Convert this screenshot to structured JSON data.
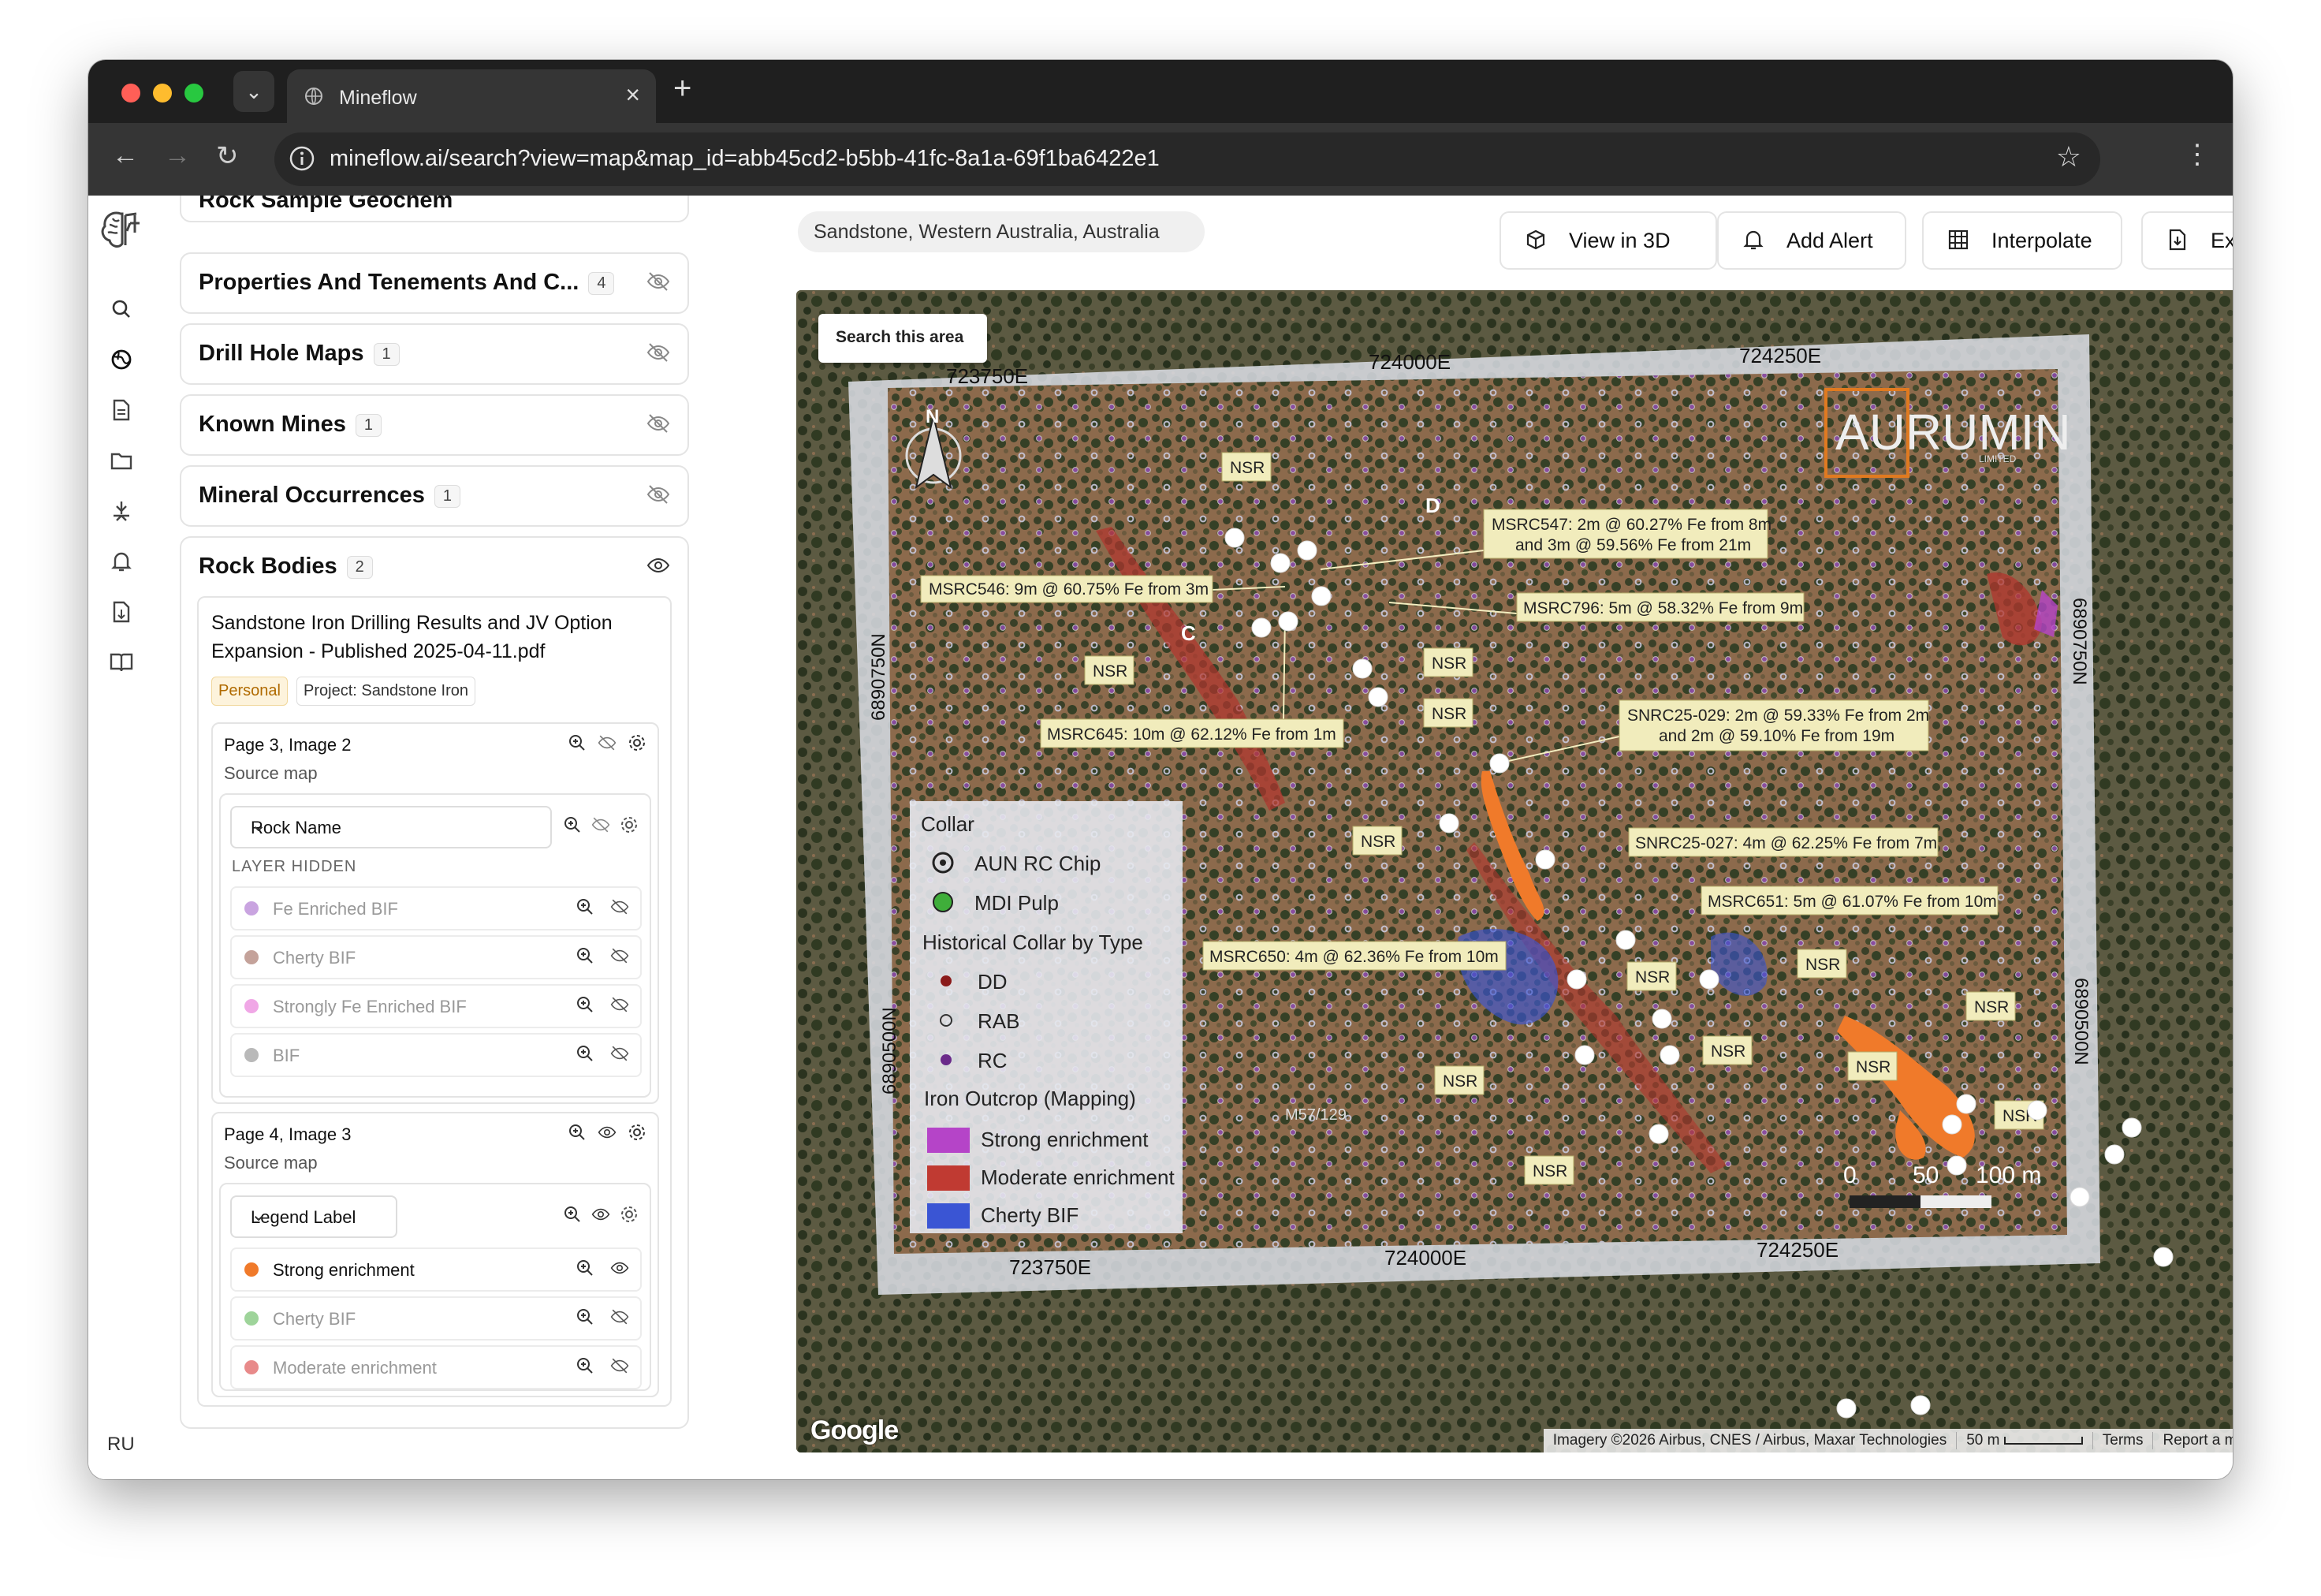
{
  "browser": {
    "tab_title": "Mineflow",
    "url": "mineflow.ai/search?view=map&map_id=abb45cd2-b5bb-41fc-8a1a-69f1ba6422e1"
  },
  "rail": {
    "user_initials": "RU"
  },
  "panel": {
    "top_card_label": "Rock Sample Geochem",
    "properties": {
      "label": "Properties And Tenements And C...",
      "count": "4"
    },
    "drill": {
      "label": "Drill Hole Maps",
      "count": "1"
    },
    "mines": {
      "label": "Known Mines",
      "count": "1"
    },
    "occurrences": {
      "label": "Mineral Occurrences",
      "count": "1"
    },
    "rock_bodies": {
      "label": "Rock Bodies",
      "count": "2",
      "document": {
        "title": "Sandstone Iron Drilling Results and JV Option Expansion - Published 2025-04-11.pdf",
        "tag_personal": "Personal",
        "tag_project": "Project: Sandstone Iron",
        "image1": {
          "title": "Page 3, Image 2",
          "source": "Source map",
          "select_value": "Rock Name",
          "hidden_label": "LAYER HIDDEN",
          "items": [
            {
              "name": "Fe Enriched BIF",
              "color": "#c9a4e0"
            },
            {
              "name": "Cherty BIF",
              "color": "#c4a29a"
            },
            {
              "name": "Strongly Fe Enriched BIF",
              "color": "#f0a7e6"
            },
            {
              "name": "BIF",
              "color": "#b9b9b9"
            }
          ]
        },
        "image2": {
          "title": "Page 4, Image 3",
          "source": "Source map",
          "select_value": "Legend Label",
          "items": [
            {
              "name": "Strong enrichment",
              "color": "#f07a2a",
              "visible": true
            },
            {
              "name": "Cherty BIF",
              "color": "#9ed49a",
              "visible": false
            },
            {
              "name": "Moderate enrichment",
              "color": "#e88a8a",
              "visible": false
            }
          ]
        }
      }
    }
  },
  "header": {
    "location": "Sandstone, Western Australia, Australia",
    "view3d": "View in 3D",
    "add_alert": "Add Alert",
    "interpolate": "Interpolate",
    "export": "Export"
  },
  "map": {
    "search_area": "Search this area",
    "google": "Google",
    "attribution": "Imagery ©2026 Airbus, CNES / Airbus, Maxar Technologies",
    "scale": "50 m",
    "terms": "Terms",
    "report": "Report a map error",
    "overlay": {
      "brand": "AURUMIN",
      "brand_sub": "LIMITED",
      "north": "N",
      "coords_top": [
        "723750E",
        "724000E",
        "724250E"
      ],
      "coords_bottom": [
        "723750E",
        "724000E",
        "724250E"
      ],
      "coords_left": [
        "6890750N",
        "6890500N"
      ],
      "coords_right": [
        "6890750N",
        "6890500N"
      ],
      "section_labels": [
        "D",
        "C"
      ],
      "tenement": "M57/129",
      "nsr": "NSR",
      "scale_labels": [
        "0",
        "50",
        "100 m"
      ],
      "callouts": [
        "MSRC547: 2m @ 60.27% Fe from 8m",
        "and 3m @ 59.56% Fe from 21m",
        "MSRC546: 9m @ 60.75% Fe from 3m",
        "MSRC796: 5m @ 58.32% Fe from 9m",
        "MSRC645: 10m @ 62.12% Fe from 1m",
        "SNRC25-029: 2m @ 59.33% Fe from 2m",
        "and 2m @ 59.10% Fe from 19m",
        "SNRC25-027: 4m @ 62.25% Fe from 7m",
        "MSRC651: 5m @ 61.07% Fe from 10m",
        "MSRC650: 4m @ 62.36% Fe from 10m"
      ],
      "legend": {
        "collar": "Collar",
        "aun": "AUN RC Chip",
        "mdi": "MDI Pulp",
        "historical": "Historical Collar by Type",
        "dd": "DD",
        "rab": "RAB",
        "rc": "RC",
        "outcrop": "Iron Outcrop (Mapping)",
        "strong": "Strong enrichment",
        "moderate": "Moderate enrichment",
        "cherty": "Cherty BIF",
        "colors": {
          "strong": "#b544c8",
          "moderate": "#c03a32",
          "cherty": "#3a55d4"
        }
      }
    }
  }
}
